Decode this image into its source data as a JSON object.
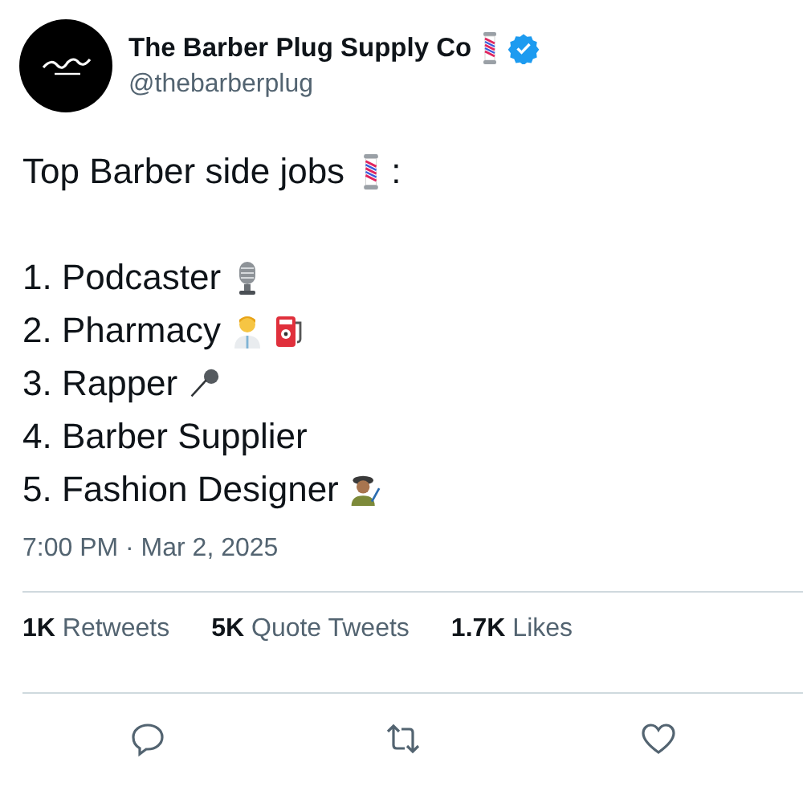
{
  "author": {
    "name": "The Barber Plug Supply Co",
    "name_icons": [
      {
        "kind": "barber-pole"
      },
      {
        "kind": "verified"
      }
    ],
    "handle": "@thebarberplug"
  },
  "tweet": {
    "headline": "Top Barber side jobs",
    "headline_icons": [
      {
        "kind": "barber-pole"
      }
    ],
    "headline_suffix": ":",
    "items": [
      {
        "text": "1. Podcaster",
        "icons": [
          {
            "kind": "studio-mic"
          }
        ]
      },
      {
        "text": "2. Pharmacy",
        "icons": [
          {
            "kind": "pharmacist"
          },
          {
            "kind": "fuel-pump"
          }
        ]
      },
      {
        "text": "3. Rapper",
        "icons": [
          {
            "kind": "mic"
          }
        ]
      },
      {
        "text": "4. Barber Supplier"
      },
      {
        "text": "5. Fashion Designer",
        "icons": [
          {
            "kind": "artist"
          }
        ]
      }
    ]
  },
  "timestamp": "7:00 PM · Mar 2, 2025",
  "stats": [
    {
      "count": "1K",
      "label": "Retweets"
    },
    {
      "count": "5K",
      "label": "Quote Tweets"
    },
    {
      "count": "1.7K",
      "label": "Likes"
    }
  ],
  "actions": [
    {
      "kind": "reply"
    },
    {
      "kind": "retweet"
    },
    {
      "kind": "like"
    }
  ]
}
